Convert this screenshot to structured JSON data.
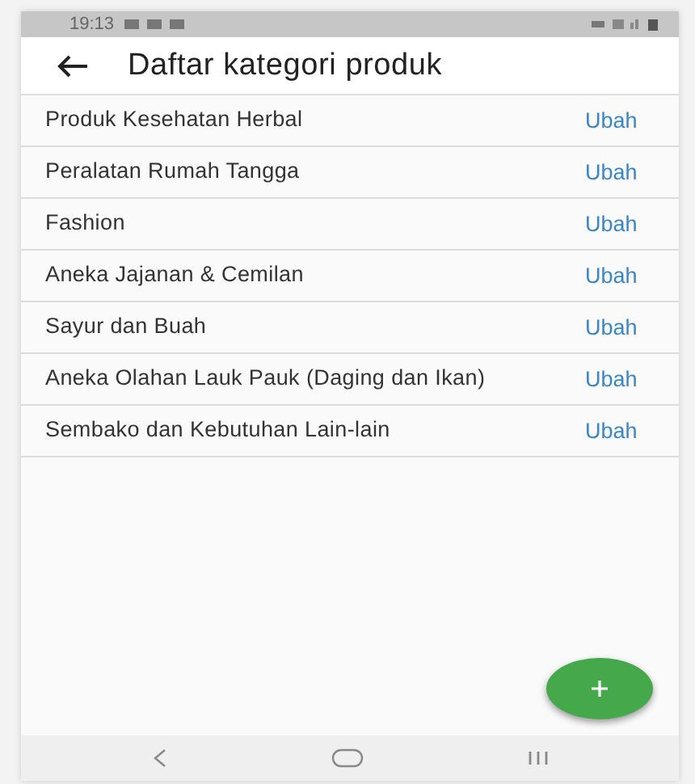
{
  "status_bar": {
    "time": "19:13"
  },
  "app_bar": {
    "title": "Daftar kategori produk"
  },
  "categories": [
    {
      "name": "Produk Kesehatan Herbal",
      "action": "Ubah"
    },
    {
      "name": "Peralatan Rumah Tangga",
      "action": "Ubah"
    },
    {
      "name": "Fashion",
      "action": "Ubah"
    },
    {
      "name": "Aneka Jajanan & Cemilan",
      "action": "Ubah"
    },
    {
      "name": "Sayur dan Buah",
      "action": "Ubah"
    },
    {
      "name": "Aneka Olahan Lauk Pauk (Daging dan Ikan)",
      "action": "Ubah"
    },
    {
      "name": "Sembako dan Kebutuhan Lain-lain",
      "action": "Ubah"
    }
  ]
}
